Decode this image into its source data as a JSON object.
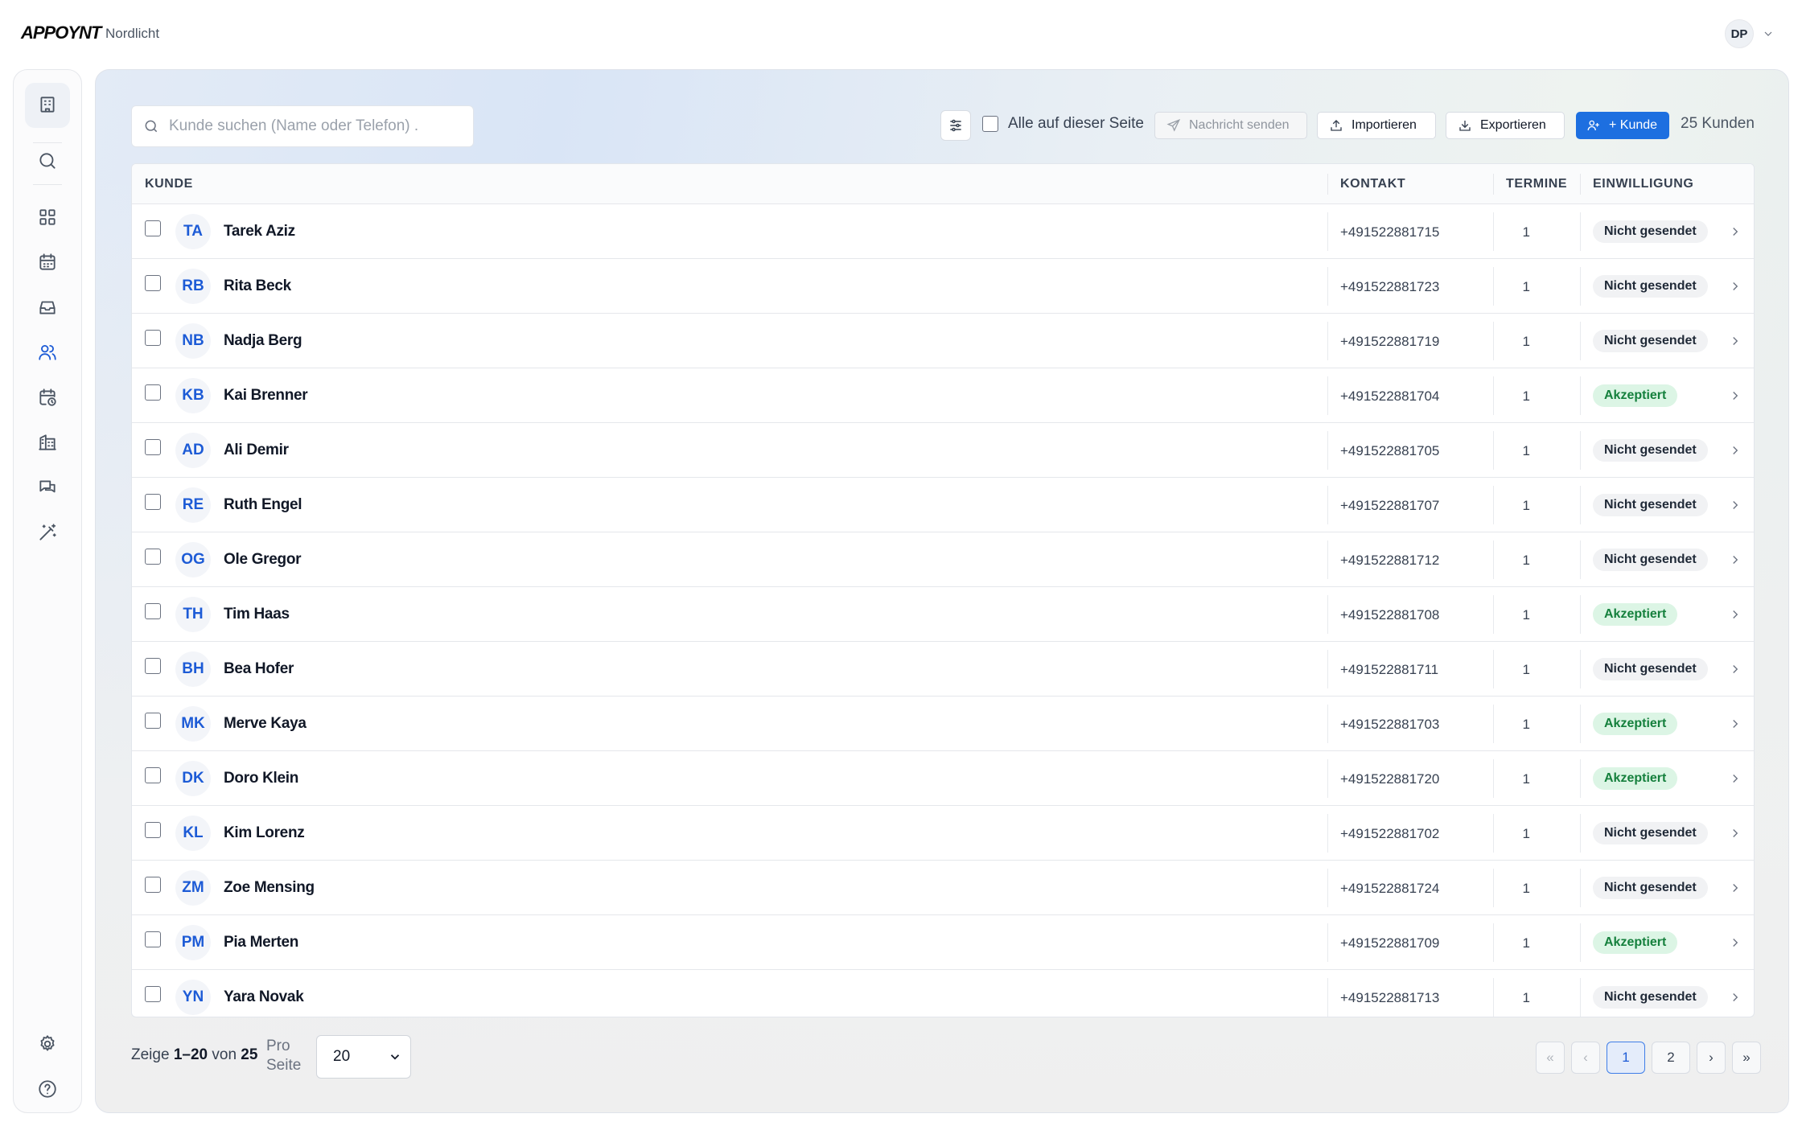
{
  "header": {
    "logo": "APPOYNT",
    "org_name": "Nordlicht",
    "user_initials": "DP"
  },
  "sidebar": {
    "items": [
      {
        "icon": "building-icon",
        "active": false
      },
      {
        "icon": "search-icon",
        "active": false
      },
      {
        "icon": "dashboard-grid-icon",
        "active": false
      },
      {
        "icon": "calendar-icon",
        "active": false
      },
      {
        "icon": "inbox-icon",
        "active": false
      },
      {
        "icon": "users-icon",
        "active": true
      },
      {
        "icon": "calendar-clock-icon",
        "active": false
      },
      {
        "icon": "office-building-icon",
        "active": false
      },
      {
        "icon": "chat-icon",
        "active": false
      },
      {
        "icon": "magic-wand-icon",
        "active": false
      },
      {
        "icon": "settings-gear-icon",
        "active": false
      },
      {
        "icon": "help-circle-icon",
        "active": false
      }
    ]
  },
  "search": {
    "placeholder": "Kunde suchen (Name oder Telefon) ."
  },
  "toolbar": {
    "select_all_label": "Alle auf dieser Seite",
    "send_message_label": "Nachricht senden",
    "import_label": "Importieren",
    "export_label": "Exportieren",
    "add_customer_label": "+ Kunde",
    "count_label": "25 Kunden"
  },
  "table": {
    "headers": {
      "customer": "KUNDE",
      "contact": "KONTAKT",
      "appointments": "TERMINE",
      "consent": "EINWILLIGUNG"
    },
    "rows": [
      {
        "initials": "TA",
        "name": "Tarek Aziz",
        "phone": "+491522881715",
        "appointments": "1",
        "consent": "Nicht gesendet",
        "status": "grey"
      },
      {
        "initials": "RB",
        "name": "Rita Beck",
        "phone": "+491522881723",
        "appointments": "1",
        "consent": "Nicht gesendet",
        "status": "grey"
      },
      {
        "initials": "NB",
        "name": "Nadja Berg",
        "phone": "+491522881719",
        "appointments": "1",
        "consent": "Nicht gesendet",
        "status": "grey"
      },
      {
        "initials": "KB",
        "name": "Kai Brenner",
        "phone": "+491522881704",
        "appointments": "1",
        "consent": "Akzeptiert",
        "status": "green"
      },
      {
        "initials": "AD",
        "name": "Ali Demir",
        "phone": "+491522881705",
        "appointments": "1",
        "consent": "Nicht gesendet",
        "status": "grey"
      },
      {
        "initials": "RE",
        "name": "Ruth Engel",
        "phone": "+491522881707",
        "appointments": "1",
        "consent": "Nicht gesendet",
        "status": "grey"
      },
      {
        "initials": "OG",
        "name": "Ole Gregor",
        "phone": "+491522881712",
        "appointments": "1",
        "consent": "Nicht gesendet",
        "status": "grey"
      },
      {
        "initials": "TH",
        "name": "Tim Haas",
        "phone": "+491522881708",
        "appointments": "1",
        "consent": "Akzeptiert",
        "status": "green"
      },
      {
        "initials": "BH",
        "name": "Bea Hofer",
        "phone": "+491522881711",
        "appointments": "1",
        "consent": "Nicht gesendet",
        "status": "grey"
      },
      {
        "initials": "MK",
        "name": "Merve Kaya",
        "phone": "+491522881703",
        "appointments": "1",
        "consent": "Akzeptiert",
        "status": "green"
      },
      {
        "initials": "DK",
        "name": "Doro Klein",
        "phone": "+491522881720",
        "appointments": "1",
        "consent": "Akzeptiert",
        "status": "green"
      },
      {
        "initials": "KL",
        "name": "Kim Lorenz",
        "phone": "+491522881702",
        "appointments": "1",
        "consent": "Nicht gesendet",
        "status": "grey"
      },
      {
        "initials": "ZM",
        "name": "Zoe Mensing",
        "phone": "+491522881724",
        "appointments": "1",
        "consent": "Nicht gesendet",
        "status": "grey"
      },
      {
        "initials": "PM",
        "name": "Pia Merten",
        "phone": "+491522881709",
        "appointments": "1",
        "consent": "Akzeptiert",
        "status": "green"
      },
      {
        "initials": "YN",
        "name": "Yara Novak",
        "phone": "+491522881713",
        "appointments": "1",
        "consent": "Nicht gesendet",
        "status": "grey"
      }
    ]
  },
  "colors": {
    "accent": "#1d6fe0",
    "accepted_bg": "#dcf5e5",
    "accepted_text": "#15803d",
    "neutral_badge": "#f1f2f4"
  },
  "footer": {
    "showing_prefix": "Zeige",
    "showing_range": "1–20",
    "showing_of": "von",
    "showing_total": "25",
    "per_page_label_1": "Pro",
    "per_page_label_2": "Seite",
    "per_page_value": "20",
    "pagination": {
      "first": "«",
      "prev": "‹",
      "pages": [
        "1",
        "2"
      ],
      "current": "1",
      "next": "›",
      "last": "»"
    }
  }
}
